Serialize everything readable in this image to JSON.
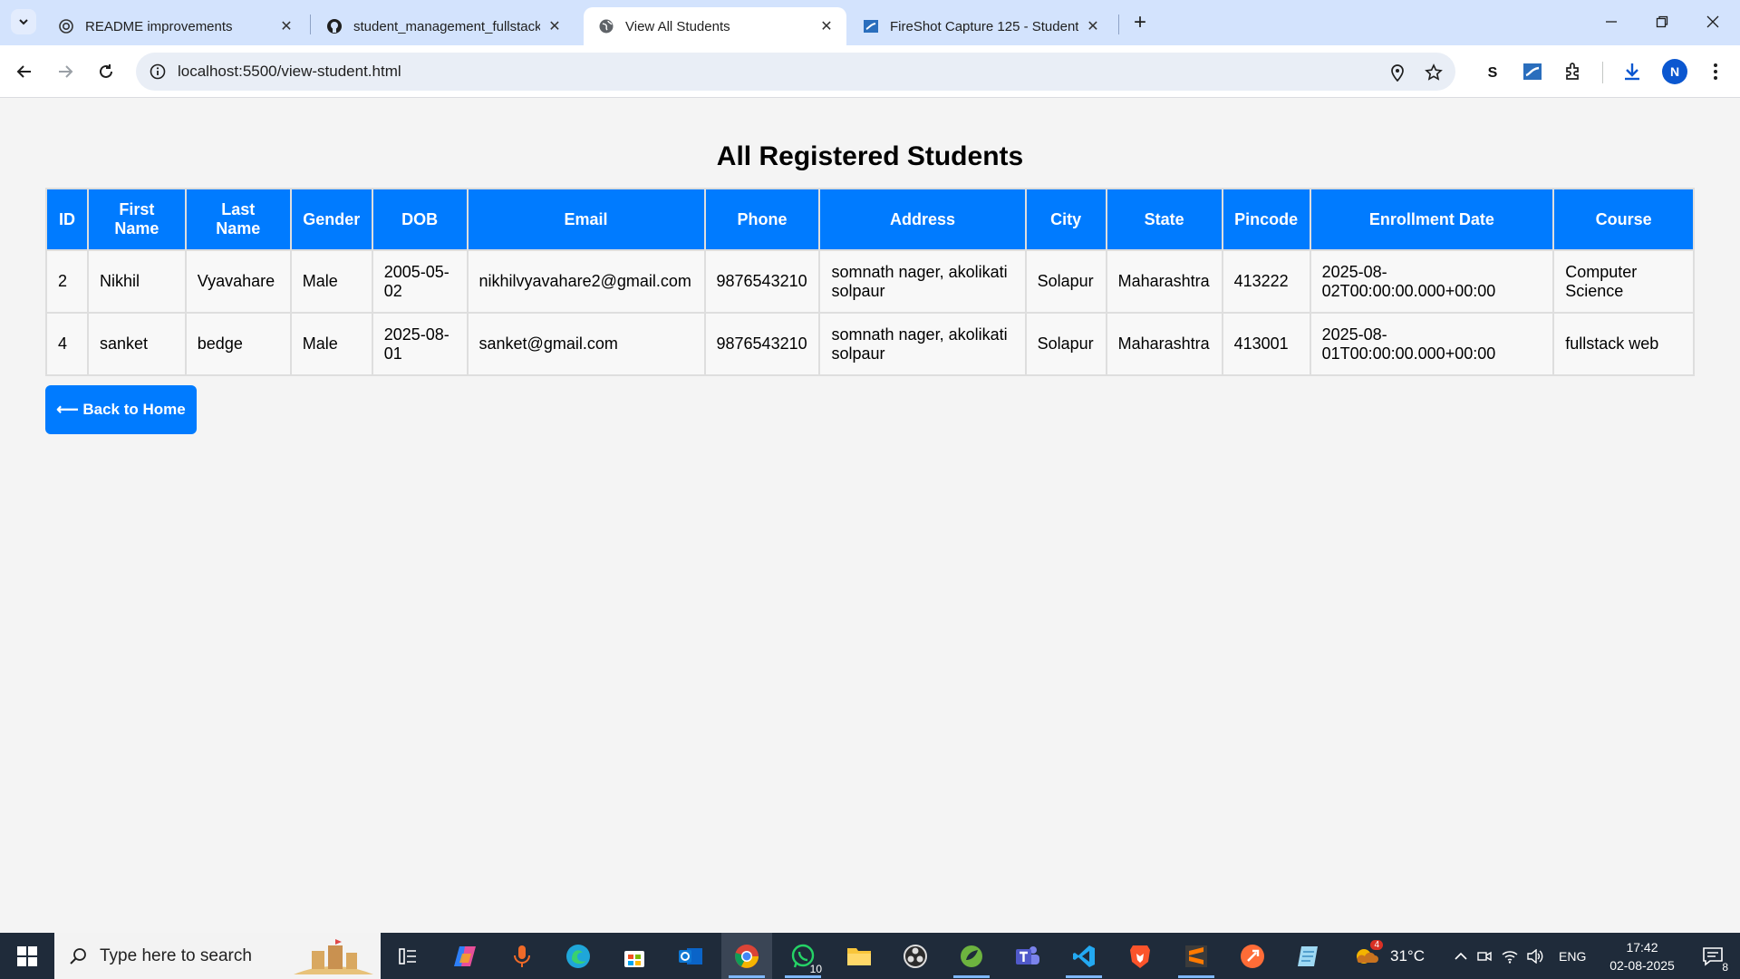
{
  "browser": {
    "tabs": [
      {
        "title": "README improvements",
        "favicon": "openai-icon"
      },
      {
        "title": "student_management_fullstack",
        "favicon": "github-icon"
      },
      {
        "title": "View All Students",
        "favicon": "globe-icon",
        "active": true
      },
      {
        "title": "FireShot Capture 125 - Student",
        "favicon": "fireshot-icon"
      }
    ],
    "url": "localhost:5500/view-student.html",
    "profile_initial": "N"
  },
  "page": {
    "title": "All Registered Students",
    "table": {
      "headers": [
        "ID",
        "First Name",
        "Last Name",
        "Gender",
        "DOB",
        "Email",
        "Phone",
        "Address",
        "City",
        "State",
        "Pincode",
        "Enrollment Date",
        "Course"
      ],
      "rows": [
        [
          "2",
          "Nikhil",
          "Vyavahare",
          "Male",
          "2005-05-02",
          "nikhilvyavahare2@gmail.com",
          "9876543210",
          "somnath nager, akolikati solpaur",
          "Solapur",
          "Maharashtra",
          "413222",
          "2025-08-02T00:00:00.000+00:00",
          "Computer Science"
        ],
        [
          "4",
          "sanket",
          "bedge",
          "Male",
          "2025-08-01",
          "sanket@gmail.com",
          "9876543210",
          "somnath nager, akolikati solpaur",
          "Solapur",
          "Maharashtra",
          "413001",
          "2025-08-01T00:00:00.000+00:00",
          "fullstack web"
        ]
      ]
    },
    "back_button": "⟵ Back to Home"
  },
  "taskbar": {
    "search_placeholder": "Type here to search",
    "whatsapp_badge": "10",
    "weather": "31°C",
    "weather_badge": "4",
    "language": "ENG",
    "time": "17:42",
    "date": "02-08-2025",
    "notifications": "8"
  },
  "colors": {
    "accent": "#007bff",
    "tabstrip": "#d3e3fd",
    "taskbar": "#1f2b3a"
  }
}
